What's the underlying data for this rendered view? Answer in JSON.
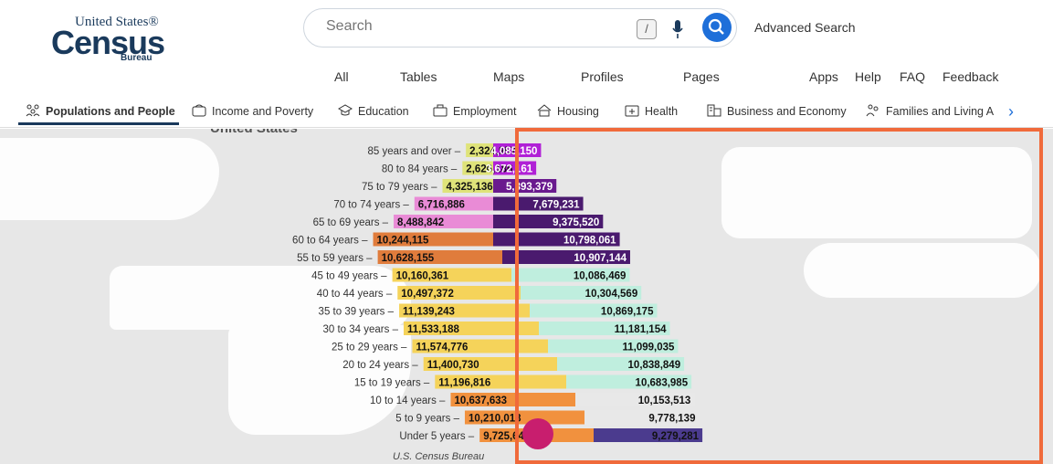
{
  "header": {
    "logo_top": "United States®",
    "logo_main": "Census",
    "logo_sub": "Bureau",
    "search_placeholder": "Search",
    "slash_key": "/",
    "advanced_search": "Advanced Search",
    "nav": [
      "All",
      "Tables",
      "Maps",
      "Profiles",
      "Pages",
      "Apps",
      "Help",
      "FAQ",
      "Feedback"
    ]
  },
  "topics": [
    {
      "label": "Populations and People",
      "icon": "people-icon",
      "active": true
    },
    {
      "label": "Income and Poverty",
      "icon": "wallet-icon",
      "active": false
    },
    {
      "label": "Education",
      "icon": "graduation-cap-icon",
      "active": false
    },
    {
      "label": "Employment",
      "icon": "briefcase-icon",
      "active": false
    },
    {
      "label": "Housing",
      "icon": "house-icon",
      "active": false
    },
    {
      "label": "Health",
      "icon": "medical-kit-icon",
      "active": false
    },
    {
      "label": "Business and Economy",
      "icon": "building-icon",
      "active": false
    },
    {
      "label": "Families and Living A",
      "icon": "family-icon",
      "active": false
    }
  ],
  "chart_data": {
    "type": "bar",
    "title": "United States",
    "categories": [
      "85 years and over",
      "80 to 84 years",
      "75 to 79 years",
      "70 to 74 years",
      "65 to 69 years",
      "60 to 64 years",
      "55 to 59 years",
      "45 to 49 years",
      "40 to 44 years",
      "35 to 39 years",
      "30 to 34 years",
      "25 to 29 years",
      "20 to 24 years",
      "15 to 19 years",
      "10 to 14 years",
      "5 to 9 years",
      "Under 5 years"
    ],
    "series": [
      {
        "values": [
          2324957,
          2626186,
          4325136,
          6716886,
          8488842,
          10244115,
          10628155,
          10160361,
          10497372,
          11139243,
          11533188,
          11574776,
          11400730,
          11196816,
          10637633,
          10210018,
          9725644
        ]
      },
      {
        "values": [
          4085150,
          3672161,
          5393379,
          7679231,
          9375520,
          10798061,
          10907144,
          10086469,
          10304569,
          10869175,
          11181154,
          11099035,
          10838849,
          10683985,
          10153513,
          9778139,
          9279281
        ]
      }
    ],
    "value_labels_left": [
      "2,324,957",
      "2,626,186",
      "4,325,136",
      "6,716,886",
      "8,488,842",
      "10,244,115",
      "10,628,155",
      "10,160,361",
      "10,497,372",
      "11,139,243",
      "11,533,188",
      "11,574,776",
      "11,400,730",
      "11,196,816",
      "10,637,633",
      "10,210,018",
      "9,725,644"
    ],
    "value_labels_right": [
      "4,085,150",
      "3,672,161",
      "5,393,379",
      "7,679,231",
      "9,375,520",
      "10,798,061",
      "10,907,144",
      "10,086,469",
      "10,304,569",
      "10,869,175",
      "11,181,154",
      "11,099,035",
      "10,838,849",
      "10,683,985",
      "10,153,513",
      "9,778,139",
      "9,279,281"
    ]
  },
  "credit": "U.S. Census Bureau",
  "colors": {
    "accent": "#1e6fd9",
    "highlight": "#f06a3b",
    "navy": "#1a3a5c"
  }
}
